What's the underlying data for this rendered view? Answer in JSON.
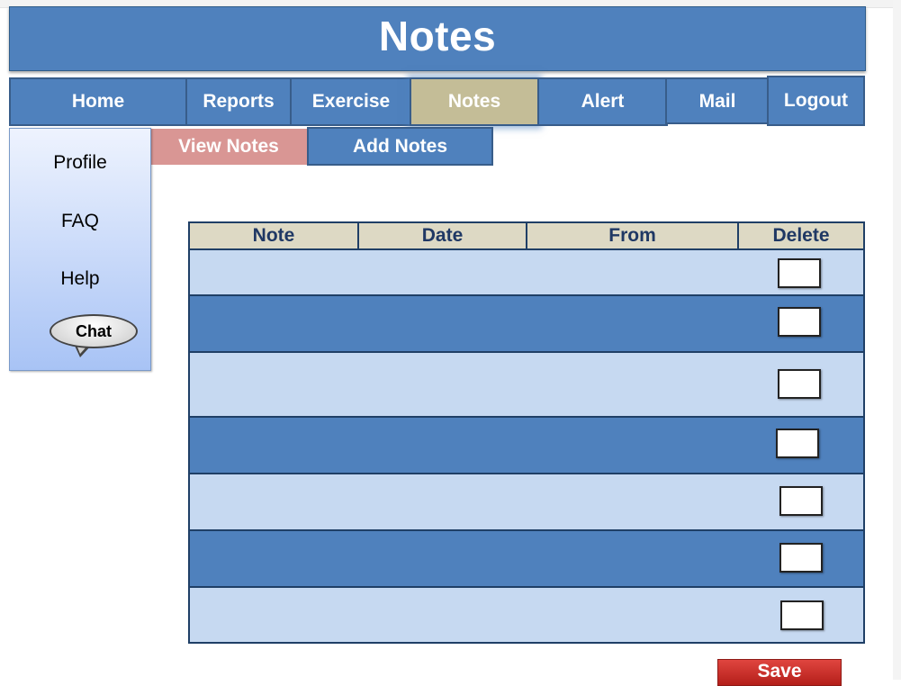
{
  "header": {
    "title": "Notes"
  },
  "nav": {
    "items": [
      {
        "label": "Home",
        "active": false
      },
      {
        "label": "Reports",
        "active": false
      },
      {
        "label": "Exercise",
        "active": false
      },
      {
        "label": "Notes",
        "active": true
      },
      {
        "label": "Alert",
        "active": false
      },
      {
        "label": "Mail",
        "active": false
      },
      {
        "label": "Logout",
        "active": false
      }
    ]
  },
  "subnav": {
    "view_notes": "View Notes",
    "add_notes": "Add Notes"
  },
  "sidebar": {
    "items": [
      {
        "label": "Profile"
      },
      {
        "label": "FAQ"
      },
      {
        "label": "Help"
      }
    ],
    "chat_label": "Chat"
  },
  "table": {
    "columns": [
      "Note",
      "Date",
      "From",
      "Delete"
    ],
    "rows": [
      {
        "note": "",
        "date": "",
        "from": "",
        "delete_checked": false
      },
      {
        "note": "",
        "date": "",
        "from": "",
        "delete_checked": false
      },
      {
        "note": "",
        "date": "",
        "from": "",
        "delete_checked": false
      },
      {
        "note": "",
        "date": "",
        "from": "",
        "delete_checked": false
      },
      {
        "note": "",
        "date": "",
        "from": "",
        "delete_checked": false
      },
      {
        "note": "",
        "date": "",
        "from": "",
        "delete_checked": false
      },
      {
        "note": "",
        "date": "",
        "from": "",
        "delete_checked": false
      }
    ]
  },
  "actions": {
    "save_label": "Save"
  },
  "colors": {
    "primary_blue": "#4f81bd",
    "light_blue": "#c6d9f1",
    "active_tab": "#c4bd97",
    "view_notes_tab": "#d99694",
    "table_header": "#ddd9c4",
    "save_red": "#c0302a"
  }
}
